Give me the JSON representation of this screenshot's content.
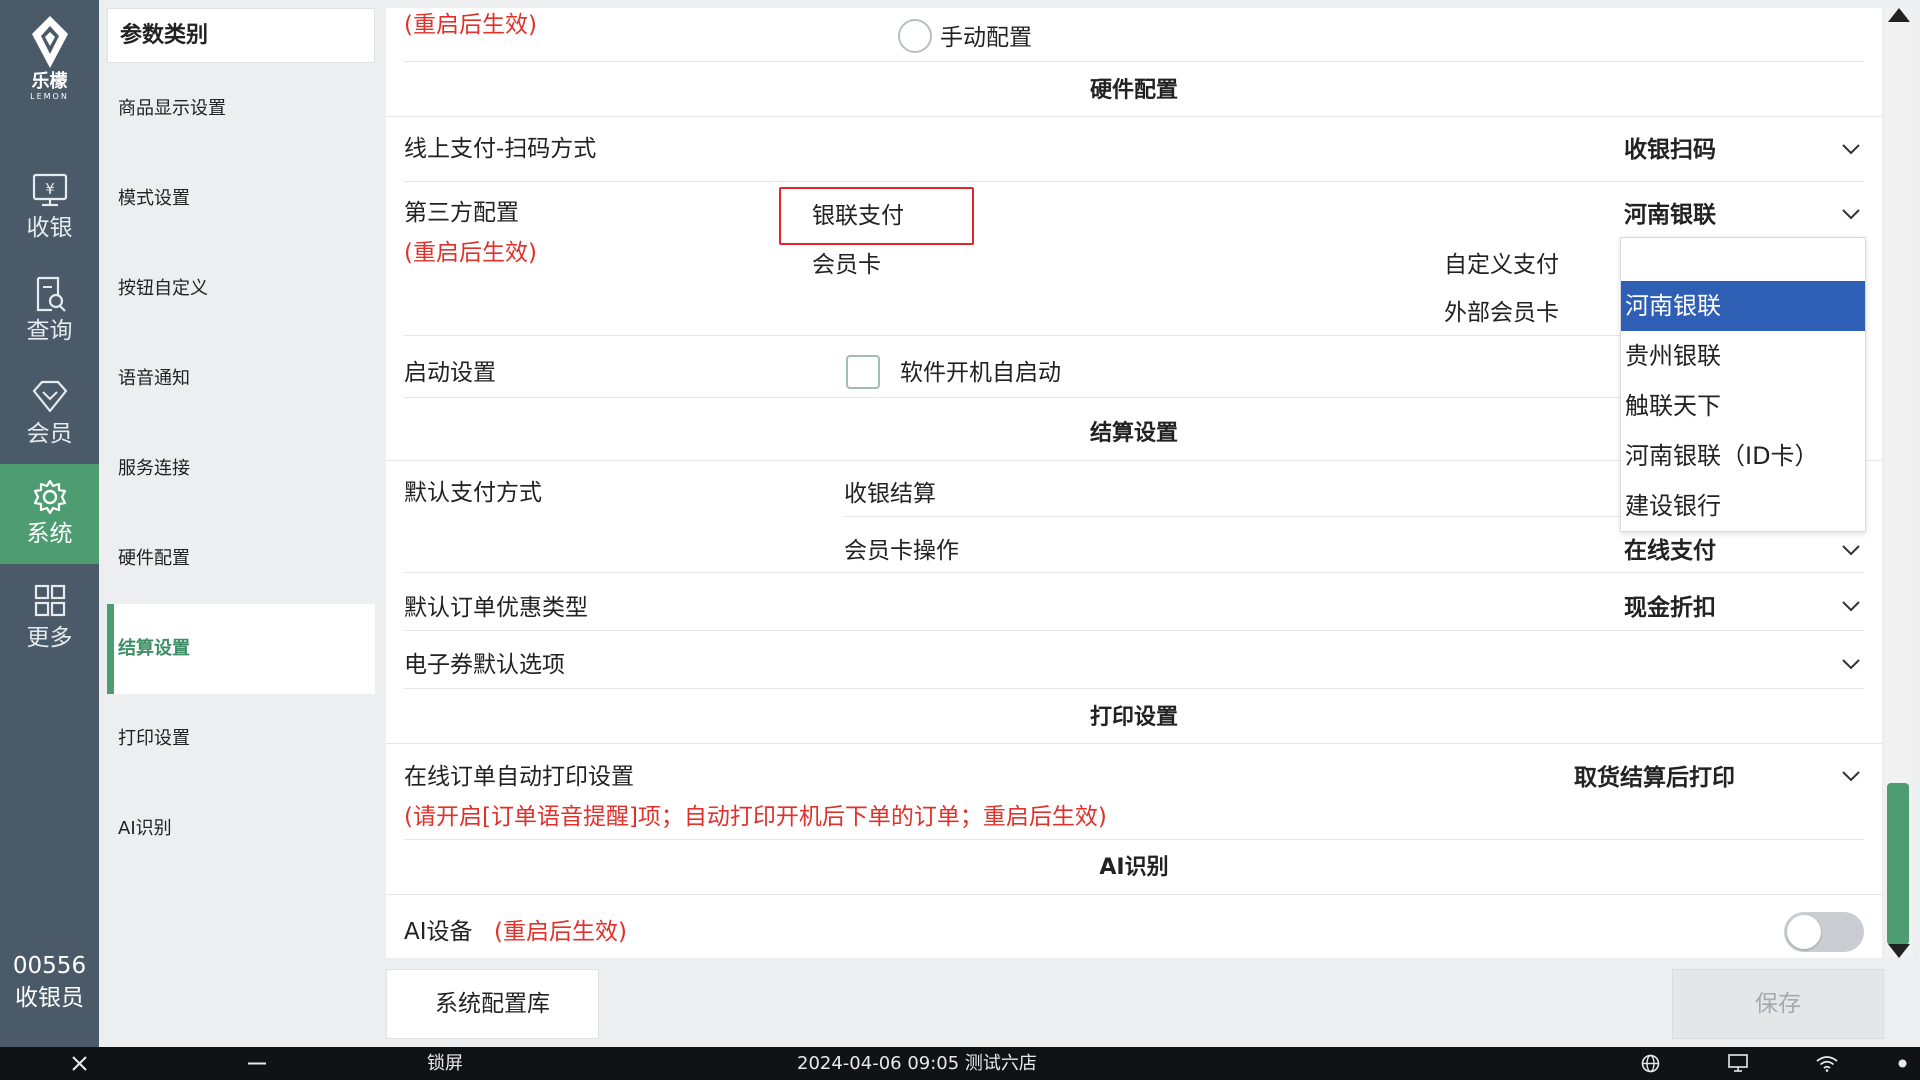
{
  "app": {
    "brand_cn": "乐檬",
    "brand_en": "LEMON"
  },
  "nav": {
    "items": [
      {
        "label": "收银",
        "icon": "cashier-icon"
      },
      {
        "label": "查询",
        "icon": "query-icon"
      },
      {
        "label": "会员",
        "icon": "member-icon"
      },
      {
        "label": "系统",
        "icon": "gear-icon",
        "active": true
      },
      {
        "label": "更多",
        "icon": "grid-icon"
      }
    ],
    "user_id": "00556",
    "user_role": "收银员"
  },
  "categories": {
    "header": "参数类别",
    "items": [
      "商品显示设置",
      "模式设置",
      "按钮自定义",
      "语音通知",
      "服务连接",
      "硬件配置",
      "结算设置",
      "打印设置",
      "AI识别"
    ],
    "active_index": 6
  },
  "settings": {
    "top_partial": {
      "note": "(重启后生效)",
      "radio_label": "手动配置"
    },
    "hardware": {
      "title": "硬件配置",
      "scan_mode_label": "线上支付-扫码方式",
      "scan_mode_value": "收银扫码",
      "third_party_label": "第三方配置",
      "third_party_note": "(重启后生效)",
      "third_party_value": "河南银联",
      "sub_options": {
        "unionpay": "银联支付",
        "member_card": "会员卡",
        "custom_pay": "自定义支付",
        "external_card": "外部会员卡"
      },
      "startup_label": "启动设置",
      "startup_checkbox_label": "软件开机自启动"
    },
    "settlement": {
      "title": "结算设置",
      "default_pay_label": "默认支付方式",
      "cashier_settle_label": "收银结算",
      "member_card_op_label": "会员卡操作",
      "member_card_op_value": "在线支付",
      "discount_type_label": "默认订单优惠类型",
      "discount_type_value": "现金折扣",
      "ecoupon_label": "电子券默认选项",
      "ecoupon_value": ""
    },
    "print": {
      "title": "打印设置",
      "auto_print_label": "在线订单自动打印设置",
      "auto_print_value": "取货结算后打印",
      "auto_print_note": "(请开启[订单语音提醒]项；自动打印开机后下单的订单；重启后生效)"
    },
    "ai": {
      "title": "AI识别",
      "device_label": "AI设备",
      "device_note": "(重启后生效)",
      "device_enabled": false
    }
  },
  "dropdown": {
    "options": [
      "河南银联",
      "贵州银联",
      "触联天下",
      "河南银联（ID卡）",
      "建设银行"
    ],
    "selected_index": 0
  },
  "footer": {
    "config_lib_label": "系统配置库",
    "save_label": "保存"
  },
  "taskbar": {
    "lock_label": "锁屏",
    "datetime_store": "2024-04-06 09:05 测试六店"
  },
  "colors": {
    "rail_bg": "#4b5a68",
    "accent_green": "#4d9c72",
    "warning_red": "#e0312b",
    "dropdown_selected": "#2e5fb5"
  }
}
